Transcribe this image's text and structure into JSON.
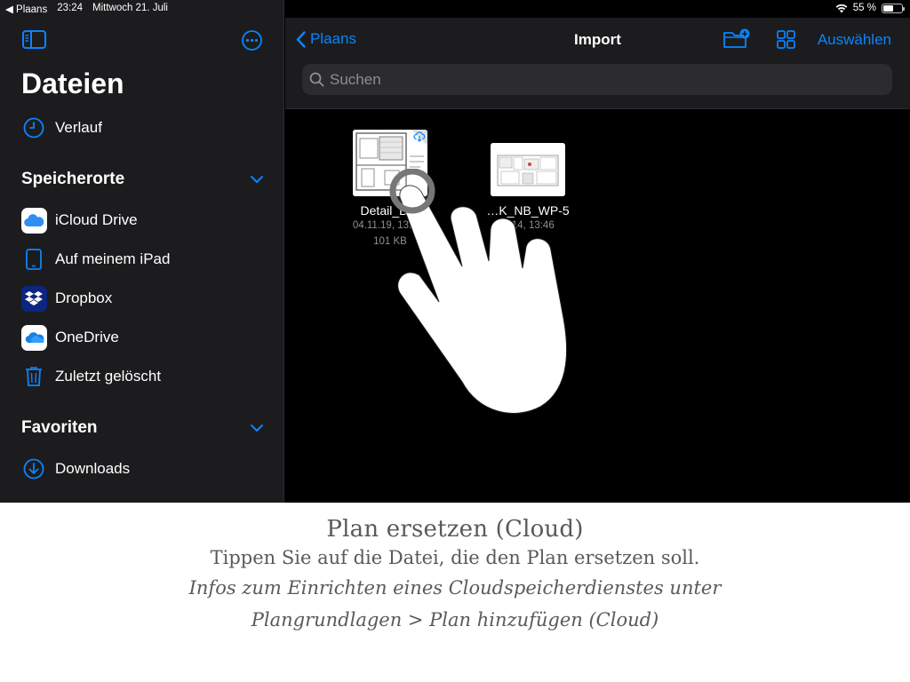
{
  "statusbar": {
    "back_app": "◀ Plaans",
    "time": "23:24",
    "date": "Mittwoch 21. Juli",
    "battery": "55 %",
    "battery_level": 0.55
  },
  "sidebar": {
    "title": "Dateien",
    "recent": {
      "label": "Verlauf",
      "icon": "clock-icon"
    },
    "locations_header": "Speicherorte",
    "locations": [
      {
        "label": "iCloud Drive",
        "icon": "icloud-icon"
      },
      {
        "label": "Auf meinem iPad",
        "icon": "ipad-icon"
      },
      {
        "label": "Dropbox",
        "icon": "dropbox-icon"
      },
      {
        "label": "OneDrive",
        "icon": "onedrive-icon"
      },
      {
        "label": "Zuletzt gelöscht",
        "icon": "trash-icon"
      }
    ],
    "favorites_header": "Favoriten",
    "favorites": [
      {
        "label": "Downloads",
        "icon": "download-icon"
      }
    ]
  },
  "navbar": {
    "back_label": "Plaans",
    "title": "Import",
    "select_label": "Auswählen"
  },
  "search": {
    "placeholder": "Suchen"
  },
  "files": [
    {
      "name": "Detail_B…",
      "date": "04.11.19, 13:0…",
      "size": "101 KB",
      "cloud": true
    },
    {
      "name": "…K_NB_WP-5",
      "date": "…14, 13:46",
      "size": ""
    }
  ],
  "caption": {
    "title": "Plan ersetzen (Cloud)",
    "text": "Tippen Sie auf die Datei, die den Plan ersetzen soll.",
    "italic_line1": "Infos zum Einrichten eines Cloudspeicherdienstes unter",
    "italic_line2": "Plangrundlagen > Plan hinzufügen (Cloud)"
  },
  "colors": {
    "accent": "#0a84ff",
    "sidebar_bg": "#1c1c1e",
    "content_bg": "#000000",
    "caption_text": "#5a5a5a"
  }
}
